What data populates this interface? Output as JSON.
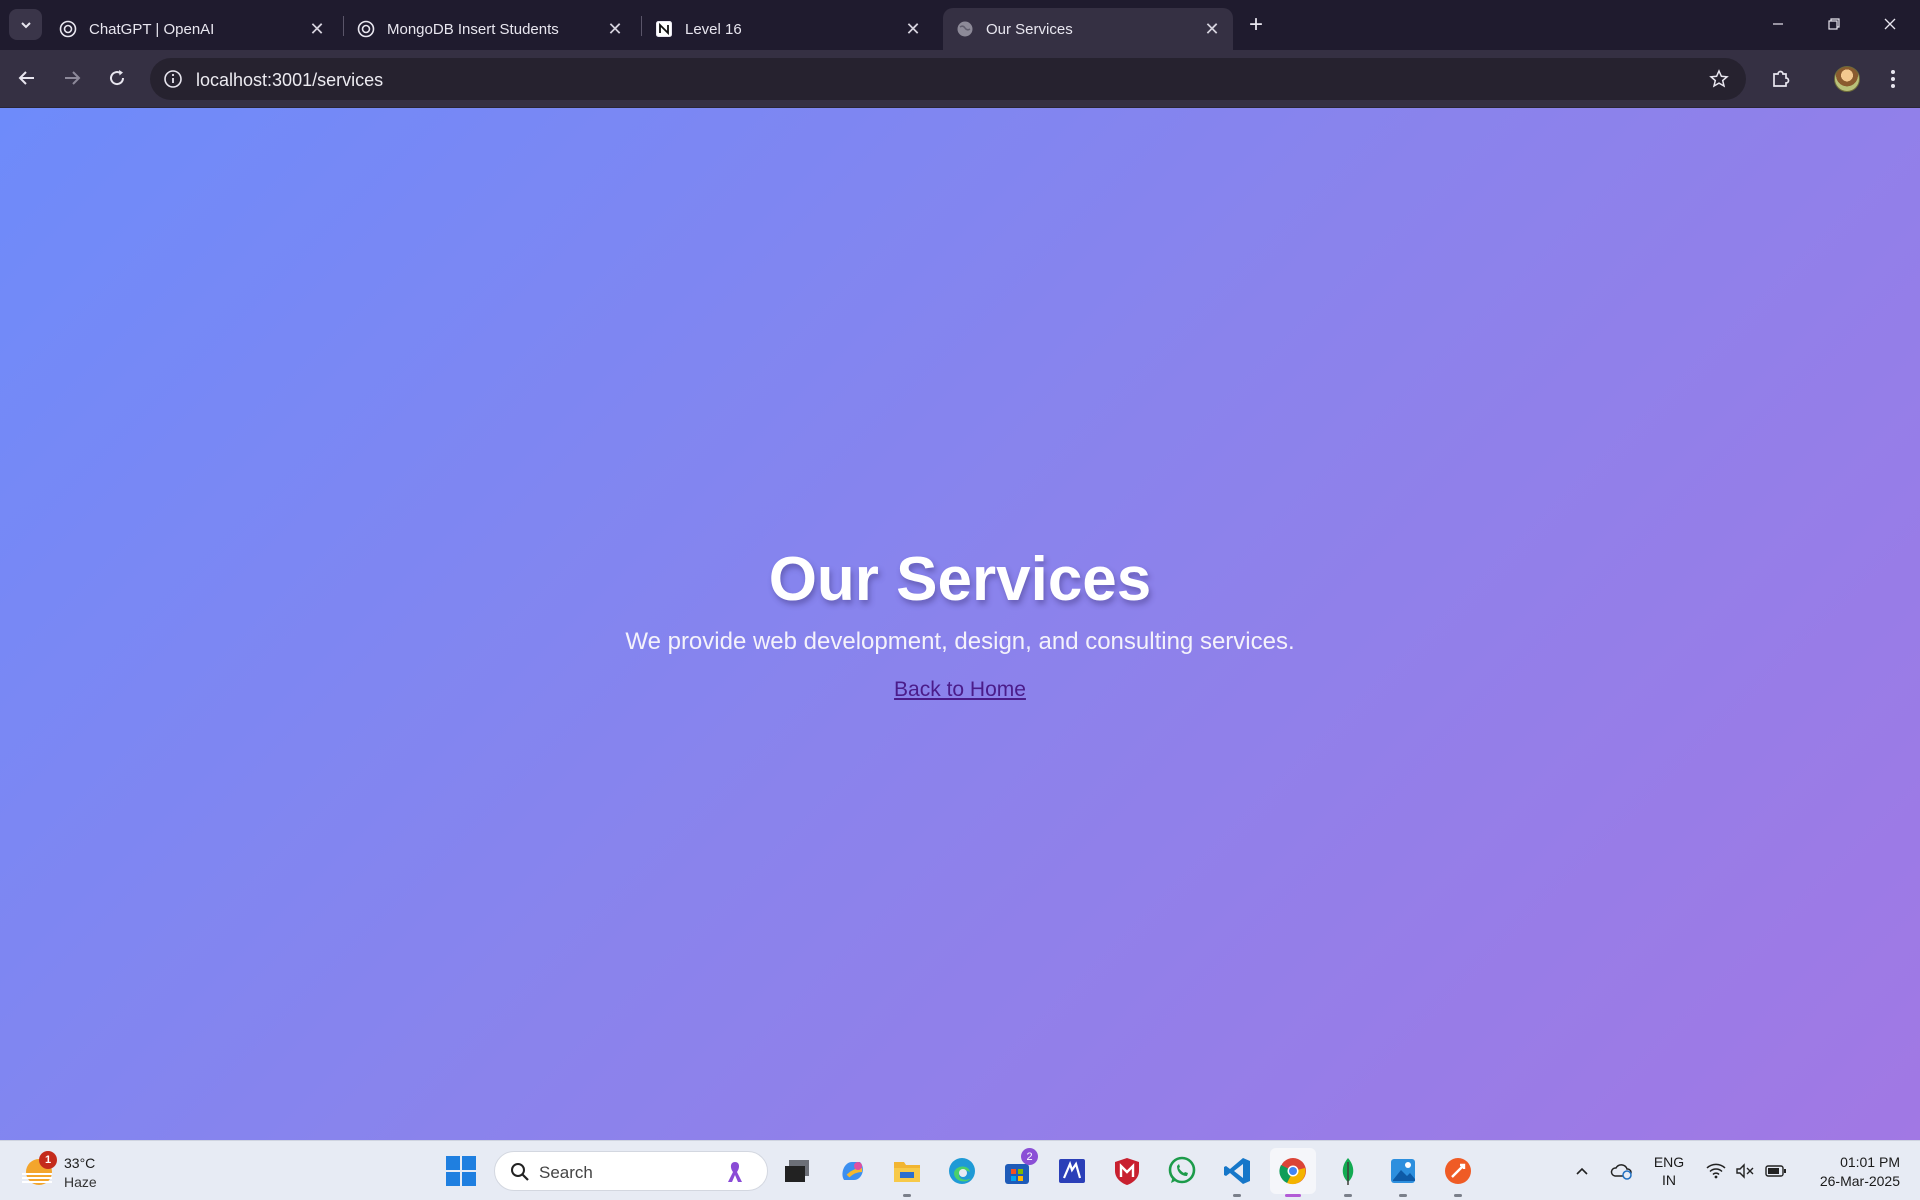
{
  "browser": {
    "tabs": [
      {
        "label": "ChatGPT | OpenAI",
        "icon": "openai-icon",
        "active": false
      },
      {
        "label": "MongoDB Insert Students",
        "icon": "openai-icon",
        "active": false
      },
      {
        "label": "Level 16",
        "icon": "notion-icon",
        "active": false
      },
      {
        "label": "Our Services",
        "icon": "globe-icon",
        "active": true
      }
    ],
    "close_glyph": "✕",
    "new_tab_glyph": "+",
    "url": "localhost:3001/services"
  },
  "page": {
    "heading": "Our Services",
    "description": "We provide web development, design, and consulting services.",
    "link_label": "Back to Home",
    "gradient_start": "#6e8bfa",
    "gradient_end": "#a178e4"
  },
  "taskbar": {
    "weather": {
      "badge": "1",
      "temp": "33°C",
      "condition": "Haze"
    },
    "search_placeholder": "Search",
    "store_badge": "2",
    "language": {
      "line1": "ENG",
      "line2": "IN"
    },
    "clock": {
      "time": "01:01 PM",
      "date": "26-Mar-2025"
    }
  }
}
